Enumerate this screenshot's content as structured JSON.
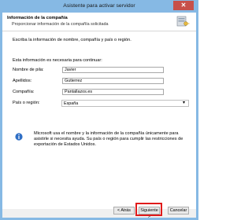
{
  "window": {
    "title": "Asistente para activar servidor",
    "close_label": "✕"
  },
  "header": {
    "title": "Información de la compañía",
    "subtitle": "Proporcionar información de la compañía solicitada"
  },
  "content": {
    "intro": "Escriba la información de nombre, compañía y país o región.",
    "required_note": "Esta información es necesaria para continuar:",
    "fields": [
      {
        "label": "Nombre de pila:",
        "value": "Javier"
      },
      {
        "label": "Apellidos:",
        "value": "Gutierrez"
      },
      {
        "label": "Compañía:",
        "value": "Pantallazos.es"
      }
    ],
    "country": {
      "label": "País o región:",
      "value": "España"
    },
    "info_text": "Microsoft usa el nombre y la información de la compañía únicamente para asistirle si necesita ayuda. Su país o región para cumplir las restricciones de exportación de Estados Unidos."
  },
  "footer": {
    "back_label": "< Atrás",
    "next_label": "Siguiente >",
    "cancel_label": "Cancelar"
  },
  "colors": {
    "title_bar": "#86b9e4",
    "close_button": "#c7504a",
    "highlight": "#e01b1b"
  }
}
